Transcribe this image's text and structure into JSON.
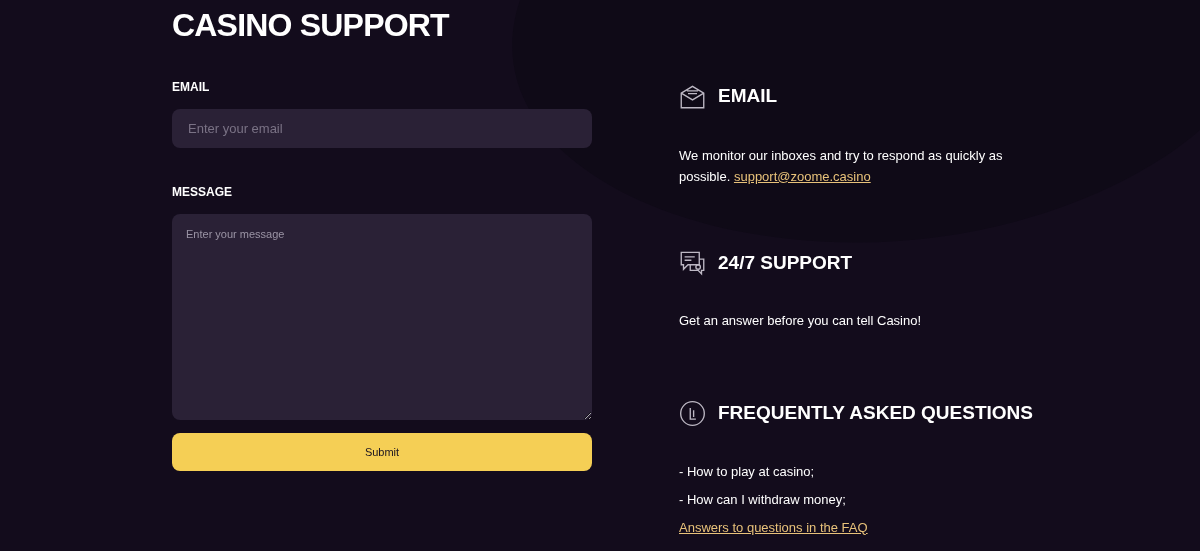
{
  "title": "CASINO SUPPORT",
  "form": {
    "fields": [
      {
        "kind": "input",
        "label": "EMAIL",
        "placeholder": "Enter your email"
      },
      {
        "kind": "textarea",
        "label": "MESSAGE",
        "placeholder": "Enter your message"
      }
    ],
    "submit": "Submit"
  },
  "sections": [
    {
      "kind": "email",
      "heading": "EMAIL",
      "items": [
        {
          "kind": "sentence",
          "text": "We monitor our inboxes and try to respond as quickly as possible.",
          "link": "support@zoome.casino"
        }
      ]
    },
    {
      "kind": "support",
      "heading": "24/7 SUPPORT",
      "items": [
        {
          "kind": "text",
          "text": "Get an answer before you can tell Casino!"
        }
      ]
    },
    {
      "kind": "faq",
      "heading": "FREQUENTLY ASKED QUESTIONS",
      "items": [
        {
          "kind": "text",
          "text": "- How to play at casino;"
        },
        {
          "kind": "text",
          "text": "- How can I withdraw money;"
        },
        {
          "kind": "link",
          "text": "Answers to questions in the FAQ"
        }
      ]
    }
  ]
}
